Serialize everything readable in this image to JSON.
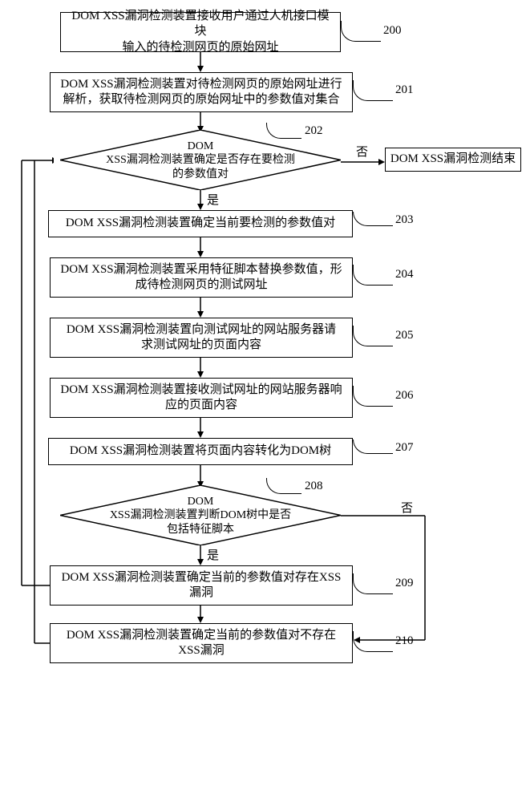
{
  "steps": {
    "s200": "DOM XSS漏洞检测装置接收用户通过人机接口模块\n输入的待检测网页的原始网址",
    "s201": "DOM XSS漏洞检测装置对待检测网页的原始网址进行\n解析，获取待检测网页的原始网址中的参数值对集合",
    "s202": "DOM\nXSS漏洞检测装置确定是否存在要检测\n的参数值对",
    "s203": "DOM XSS漏洞检测装置确定当前要检测的参数值对",
    "s204": "DOM XSS漏洞检测装置采用特征脚本替换参数值，形\n成待检测网页的测试网址",
    "s205": "DOM XSS漏洞检测装置向测试网址的网站服务器请\n求测试网址的页面内容",
    "s206": "DOM XSS漏洞检测装置接收测试网址的网站服务器响\n应的页面内容",
    "s207": "DOM XSS漏洞检测装置将页面内容转化为DOM树",
    "s208": "DOM\nXSS漏洞检测装置判断DOM树中是否\n包括特征脚本",
    "s209": "DOM XSS漏洞检测装置确定当前的参数值对存在XSS\n漏洞",
    "s210": "DOM XSS漏洞检测装置确定当前的参数值对不存在\nXSS漏洞",
    "end": "DOM XSS漏洞检测结束"
  },
  "labels": {
    "n200": "200",
    "n201": "201",
    "n202": "202",
    "n203": "203",
    "n204": "204",
    "n205": "205",
    "n206": "206",
    "n207": "207",
    "n208": "208",
    "n209": "209",
    "n210": "210"
  },
  "branch": {
    "yes": "是",
    "no": "否"
  }
}
